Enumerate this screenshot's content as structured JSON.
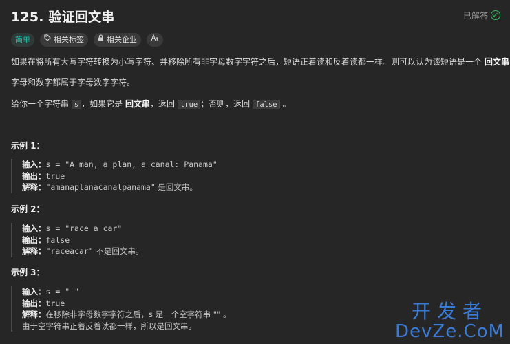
{
  "header": {
    "title": "125. 验证回文串",
    "status": "已解答"
  },
  "tags": [
    {
      "label": "简单",
      "icon": ""
    },
    {
      "label": "相关标签",
      "icon": "tag-icon"
    },
    {
      "label": "相关企业",
      "icon": "lock-icon"
    },
    {
      "label": "",
      "icon": "font-size-icon"
    }
  ],
  "description": {
    "p1_text": "如果在将所有大写字符转换为小写字符、并移除所有非字母数字字符之后，短语正着读和反着读都一样。则可以认为该短语是一个",
    "p1_bold": "回文串",
    "p1_end": "。",
    "p2": "字母和数字都属于字母数字字符。",
    "p3_a": "给你一个字符串",
    "p3_code_s": "s",
    "p3_b": "，如果它是",
    "p3_bold": "回文串",
    "p3_c": "，返回",
    "p3_code_true": "true",
    "p3_d": "；否则，返回",
    "p3_code_false": "false",
    "p3_e": "。"
  },
  "examples": [
    {
      "title": "示例 1：",
      "input_label": "输入：",
      "input": "s = \"A man, a plan, a canal: Panama\"",
      "output_label": "输出：",
      "output": "true",
      "explain_label": "解释：",
      "explain_code": "\"amanaplanacanalpanama\"",
      "explain_text": " 是回文串。"
    },
    {
      "title": "示例 2：",
      "input_label": "输入：",
      "input": "s = \"race a car\"",
      "output_label": "输出：",
      "output": "false",
      "explain_label": "解释：",
      "explain_code": "\"raceacar\"",
      "explain_text": " 不是回文串。"
    },
    {
      "title": "示例 3：",
      "input_label": "输入：",
      "input": "s = \" \"",
      "output_label": "输出：",
      "output": "true",
      "explain_label": "解释：",
      "explain_text": "在移除非字母数字字符之后，s 是一个空字符串 \"\" 。",
      "explain_line2": "由于空字符串正着反着读都一样，所以是回文串。"
    }
  ],
  "watermark": {
    "cn": "开发者",
    "en": "DevZe.CoM"
  },
  "colors": {
    "background": "#262626",
    "easy": "#1cc3aa",
    "watermark": "#3a7bd5"
  }
}
